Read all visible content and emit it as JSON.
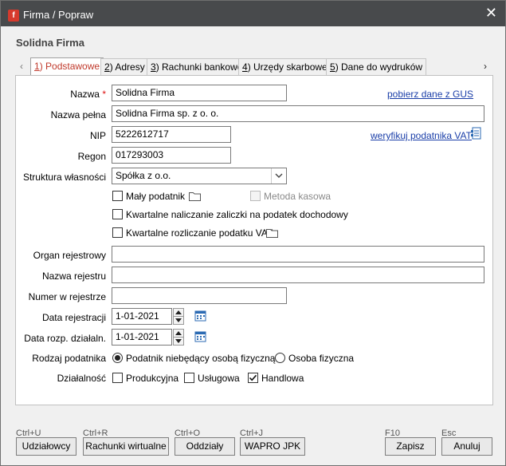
{
  "window": {
    "title": "Firma / Popraw"
  },
  "frame_title": "Solidna Firma",
  "tabs": [
    {
      "num": "1",
      "label": ") Podstawowe"
    },
    {
      "num": "2",
      "label": ") Adresy"
    },
    {
      "num": "3",
      "label": ") Rachunki bankowe"
    },
    {
      "num": "4",
      "label": ") Urzędy skarbowe"
    },
    {
      "num": "5",
      "label": ") Dane do wydruków"
    }
  ],
  "form": {
    "nazwa_label": "Nazwa",
    "nazwa_req": "*",
    "nazwa_value": "Solidna Firma",
    "gus_link": "pobierz dane z GUS",
    "nazwa_pelna_label": "Nazwa pełna",
    "nazwa_pelna_value": "Solidna Firma sp. z o. o.",
    "nip_label": "NIP",
    "nip_value": "5222612717",
    "vat_link": "weryfikuj podatnika VAT",
    "regon_label": "Regon",
    "regon_value": "017293003",
    "struktura_label": "Struktura własności",
    "struktura_value": "Spółka z o.o.",
    "maly_podatnik": "Mały podatnik",
    "metoda_kasowa": "Metoda kasowa",
    "kw_zaliczki": "Kwartalne naliczanie zaliczki na podatek dochodowy",
    "kw_vat": "Kwartalne rozliczanie podatku VAT",
    "organ_label": "Organ rejestrowy",
    "organ_value": "",
    "nazwa_rej_label": "Nazwa rejestru",
    "nazwa_rej_value": "",
    "numer_rej_label": "Numer w rejestrze",
    "numer_rej_value": "",
    "data_rej_label": "Data rejestracji",
    "data_rej_value": "1-01-2021",
    "data_rozp_label": "Data rozp. działaln.",
    "data_rozp_value": "1-01-2021",
    "rodzaj_label": "Rodzaj podatnika",
    "rodzaj_opt1": "Podatnik niebędący osobą fizyczną",
    "rodzaj_opt2": "Osoba fizyczna",
    "dzialalnosc_label": "Działalność",
    "dz_produkcyjna": "Produkcyjna",
    "dz_uslugowa": "Usługowa",
    "dz_handlowa": "Handlowa"
  },
  "footer": {
    "udzialowcy": {
      "hotkey": "Ctrl+U",
      "label": "Udziałowcy"
    },
    "rachunki": {
      "hotkey": "Ctrl+R",
      "label": "Rachunki wirtualne"
    },
    "oddzialy": {
      "hotkey": "Ctrl+O",
      "label": "Oddziały"
    },
    "jpk": {
      "hotkey": "Ctrl+J",
      "label": "WAPRO JPK"
    },
    "zapisz": {
      "hotkey": "F10",
      "label": "Zapisz"
    },
    "anuluj": {
      "hotkey": "Esc",
      "label": "Anuluj"
    }
  },
  "colors": {
    "titlebar": "#484a4c",
    "active_tab": "#c0392b",
    "link": "#1a3ea8"
  }
}
